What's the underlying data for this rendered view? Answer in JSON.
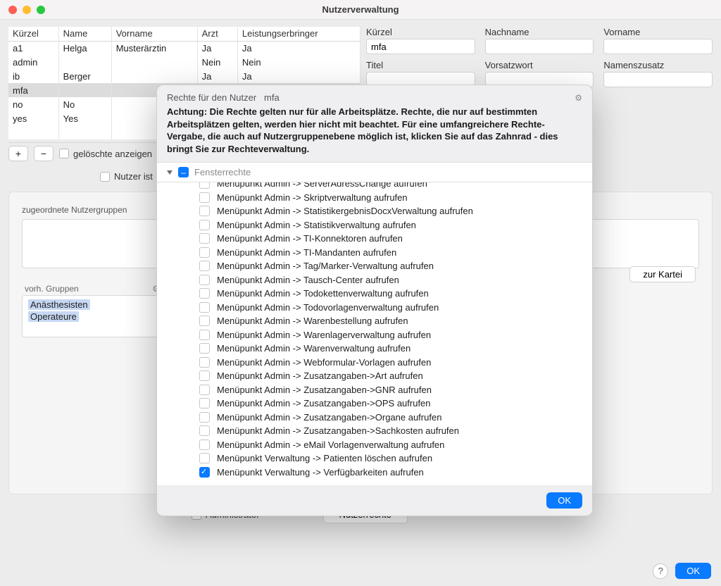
{
  "window": {
    "title": "Nutzerverwaltung"
  },
  "table": {
    "headers": [
      "Kürzel",
      "Name",
      "Vorname",
      "Arzt",
      "Leistungserbringer"
    ],
    "rows": [
      {
        "c0": "a1",
        "c1": "Helga",
        "c2": "Musterärztin",
        "c3": "Ja",
        "c4": "Ja"
      },
      {
        "c0": "admin",
        "c1": "",
        "c2": "",
        "c3": "Nein",
        "c4": "Nein"
      },
      {
        "c0": "ib",
        "c1": "Berger",
        "c2": "",
        "c3": "Ja",
        "c4": "Ja"
      },
      {
        "c0": "mfa",
        "c1": "",
        "c2": "",
        "c3": "",
        "c4": ""
      },
      {
        "c0": "no",
        "c1": "No",
        "c2": "",
        "c3": "",
        "c4": ""
      },
      {
        "c0": "yes",
        "c1": "Yes",
        "c2": "",
        "c3": "",
        "c4": ""
      }
    ],
    "show_deleted": "gelöschte anzeigen"
  },
  "form": {
    "labels": {
      "kuerzel": "Kürzel",
      "nachname": "Nachname",
      "vorname": "Vorname",
      "titel": "Titel",
      "vorsatzwort": "Vorsatzwort",
      "namenszusatz": "Namenszusatz"
    },
    "values": {
      "kuerzel": "mfa",
      "nachname": "",
      "vorname": "",
      "titel": "",
      "vorsatzwort": "",
      "namenszusatz": ""
    }
  },
  "checks": {
    "nutzer_ist": "Nutzer ist",
    "administrator": "Administrator"
  },
  "groups": {
    "assigned_label": "zugeordnete Nutzergruppen",
    "available_label": "vorh. Gruppen",
    "available": [
      "Anästhesisten",
      "Operateure"
    ]
  },
  "buttons": {
    "zur_kartei": "zur Kartei",
    "nutzerrechte": "Nutzerrechte",
    "ok": "OK",
    "help": "?"
  },
  "modal": {
    "title_prefix": "Rechte für den Nutzer",
    "user": "mfa",
    "warning": "Achtung: Die Rechte gelten nur für alle Arbeitsplätze. Rechte, die nur auf bestimmten Arbeitsplätzen gelten, werden hier nicht mit beachtet. Für eine umfangreichere Rechte-Vergabe, die auch auf Nutzergruppenebene möglich ist, klicken Sie auf das Zahnrad - dies bringt Sie zur Rechteverwaltung.",
    "section": "Fensterrechte",
    "rights": [
      {
        "label": "Menüpunkt Admin -> ServerAdressChange aufrufen",
        "checked": false,
        "cut": true
      },
      {
        "label": "Menüpunkt Admin -> Skriptverwaltung aufrufen",
        "checked": false
      },
      {
        "label": "Menüpunkt Admin -> StatistikergebnisDocxVerwaltung aufrufen",
        "checked": false
      },
      {
        "label": "Menüpunkt Admin -> Statistikverwaltung aufrufen",
        "checked": false
      },
      {
        "label": "Menüpunkt Admin -> TI-Konnektoren aufrufen",
        "checked": false
      },
      {
        "label": "Menüpunkt Admin -> TI-Mandanten aufrufen",
        "checked": false
      },
      {
        "label": "Menüpunkt Admin -> Tag/Marker-Verwaltung aufrufen",
        "checked": false
      },
      {
        "label": "Menüpunkt Admin -> Tausch-Center aufrufen",
        "checked": false
      },
      {
        "label": "Menüpunkt Admin -> Todokettenverwaltung aufrufen",
        "checked": false
      },
      {
        "label": "Menüpunkt Admin -> Todovorlagenverwaltung aufrufen",
        "checked": false
      },
      {
        "label": "Menüpunkt Admin -> Warenbestellung aufrufen",
        "checked": false
      },
      {
        "label": "Menüpunkt Admin -> Warenlagerverwaltung aufrufen",
        "checked": false
      },
      {
        "label": "Menüpunkt Admin -> Warenverwaltung aufrufen",
        "checked": false
      },
      {
        "label": "Menüpunkt Admin -> Webformular-Vorlagen aufrufen",
        "checked": false
      },
      {
        "label": "Menüpunkt Admin -> Zusatzangaben->Art aufrufen",
        "checked": false
      },
      {
        "label": "Menüpunkt Admin -> Zusatzangaben->GNR aufrufen",
        "checked": false
      },
      {
        "label": "Menüpunkt Admin -> Zusatzangaben->OPS aufrufen",
        "checked": false
      },
      {
        "label": "Menüpunkt Admin -> Zusatzangaben->Organe aufrufen",
        "checked": false
      },
      {
        "label": "Menüpunkt Admin -> Zusatzangaben->Sachkosten aufrufen",
        "checked": false
      },
      {
        "label": "Menüpunkt Admin -> eMail Vorlagenverwaltung aufrufen",
        "checked": false
      },
      {
        "label": "Menüpunkt Verwaltung -> Patienten löschen aufrufen",
        "checked": false
      },
      {
        "label": "Menüpunkt Verwaltung -> Verfügbarkeiten aufrufen",
        "checked": true
      }
    ],
    "ok": "OK"
  }
}
